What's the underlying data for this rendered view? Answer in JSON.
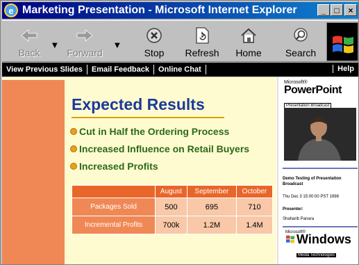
{
  "window": {
    "title": "Marketing Presentation - Microsoft Internet Explorer",
    "controls": {
      "minimize": "_",
      "maximize": "□",
      "close": "×"
    }
  },
  "toolbar": {
    "back": "Back",
    "forward": "Forward",
    "stop": "Stop",
    "refresh": "Refresh",
    "home": "Home",
    "search": "Search"
  },
  "nav": {
    "items": [
      "View Previous Slides",
      "Email Feedback",
      "Online Chat"
    ],
    "help": "Help"
  },
  "slide": {
    "title": "Expected Results",
    "bullets": [
      "Cut in Half the Ordering Process",
      "Increased Influence on Retail Buyers",
      "Increased Profits"
    ],
    "table": {
      "headers": [
        "",
        "August",
        "September",
        "October"
      ],
      "rows": [
        {
          "label": "Packages Sold",
          "values": [
            "500",
            "695",
            "710"
          ]
        },
        {
          "label": "Incremental Profits",
          "values": [
            "700k",
            "1.2M",
            "1.4M"
          ]
        }
      ]
    }
  },
  "sidebar": {
    "pp_logo": {
      "ms": "Microsoft®",
      "name": "PowerPoint",
      "sub": "Presentation Broadcast"
    },
    "event_title": "Demo Testing of Presentation Broadcast",
    "datetime": "Thu Dec 3 15:00:00 PST 1998",
    "presenter_label": "Presenter:",
    "presenter_name": "Shaharib Panara",
    "win_logo": {
      "ms": "Microsoft®",
      "name": "Windows",
      "sub": "Media Technologies"
    }
  },
  "colors": {
    "title_bar": "#000080",
    "slide_bg": "#fffbd0",
    "accent_orange": "#f08855",
    "title_blue": "#1a3a9a",
    "bullet_green": "#2a6a1a"
  }
}
